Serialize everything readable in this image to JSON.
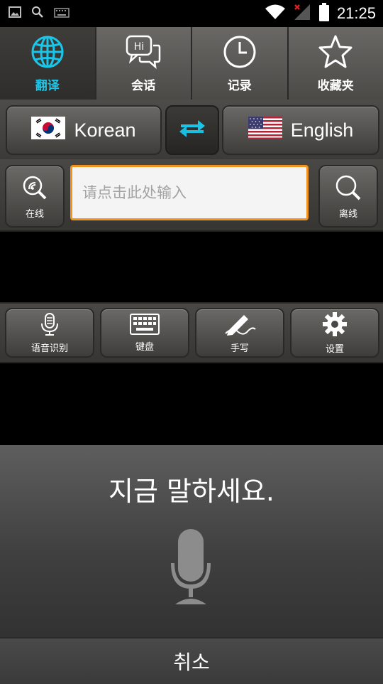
{
  "status_bar": {
    "time": "21:25"
  },
  "tabs": [
    {
      "label": "翻译",
      "icon": "globe-icon",
      "active": true
    },
    {
      "label": "会话",
      "icon": "chat-bubble-icon",
      "active": false
    },
    {
      "label": "记录",
      "icon": "clock-icon",
      "active": false
    },
    {
      "label": "收藏夹",
      "icon": "star-icon",
      "active": false
    }
  ],
  "languages": {
    "source": "Korean",
    "target": "English"
  },
  "input": {
    "placeholder": "请点击此处输入",
    "online_label": "在线",
    "offline_label": "离线"
  },
  "toolbar": {
    "voice_label": "语音识别",
    "keyboard_label": "键盘",
    "handwriting_label": "手写",
    "settings_label": "设置"
  },
  "voice_dialog": {
    "prompt": "지금 말하세요.",
    "cancel_label": "취소"
  },
  "colors": {
    "accent": "#19c6e8",
    "input_border": "#f3921c"
  }
}
